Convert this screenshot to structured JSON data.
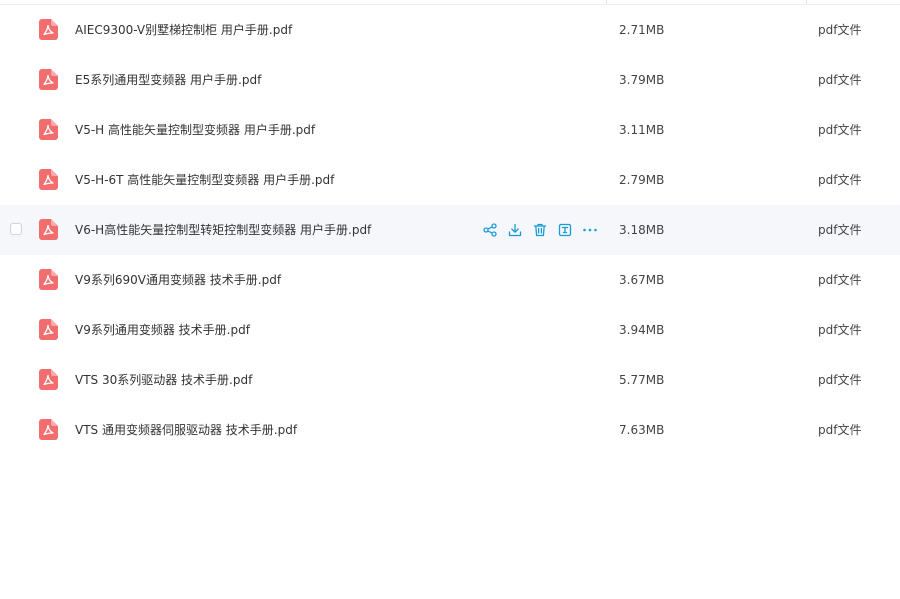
{
  "colors": {
    "accent": "#1a9bd7",
    "pdf_icon": "#f26d6d",
    "hover_row": "#f5f7fb"
  },
  "files": [
    {
      "name": "AIEC9300-V别墅梯控制柜 用户手册.pdf",
      "size": "2.71MB",
      "type": "pdf文件",
      "icon": "pdf-icon"
    },
    {
      "name": "E5系列通用型变频器 用户手册.pdf",
      "size": "3.79MB",
      "type": "pdf文件",
      "icon": "pdf-icon"
    },
    {
      "name": "V5-H 高性能矢量控制型变频器 用户手册.pdf",
      "size": "3.11MB",
      "type": "pdf文件",
      "icon": "pdf-icon"
    },
    {
      "name": "V5-H-6T 高性能矢量控制型变频器 用户手册.pdf",
      "size": "2.79MB",
      "type": "pdf文件",
      "icon": "pdf-icon"
    },
    {
      "name": "V6-H高性能矢量控制型转矩控制型变频器 用户手册.pdf",
      "size": "3.18MB",
      "type": "pdf文件",
      "icon": "pdf-icon",
      "hovered": true
    },
    {
      "name": "V9系列690V通用变频器 技术手册.pdf",
      "size": "3.67MB",
      "type": "pdf文件",
      "icon": "pdf-icon"
    },
    {
      "name": "V9系列通用变频器 技术手册.pdf",
      "size": "3.94MB",
      "type": "pdf文件",
      "icon": "pdf-icon"
    },
    {
      "name": "VTS 30系列驱动器 技术手册.pdf",
      "size": "5.77MB",
      "type": "pdf文件",
      "icon": "pdf-icon"
    },
    {
      "name": "VTS 通用变频器伺服驱动器 技术手册.pdf",
      "size": "7.63MB",
      "type": "pdf文件",
      "icon": "pdf-icon"
    }
  ],
  "hover_actions": [
    "share-icon",
    "download-icon",
    "delete-icon",
    "rename-icon",
    "more-icon"
  ]
}
